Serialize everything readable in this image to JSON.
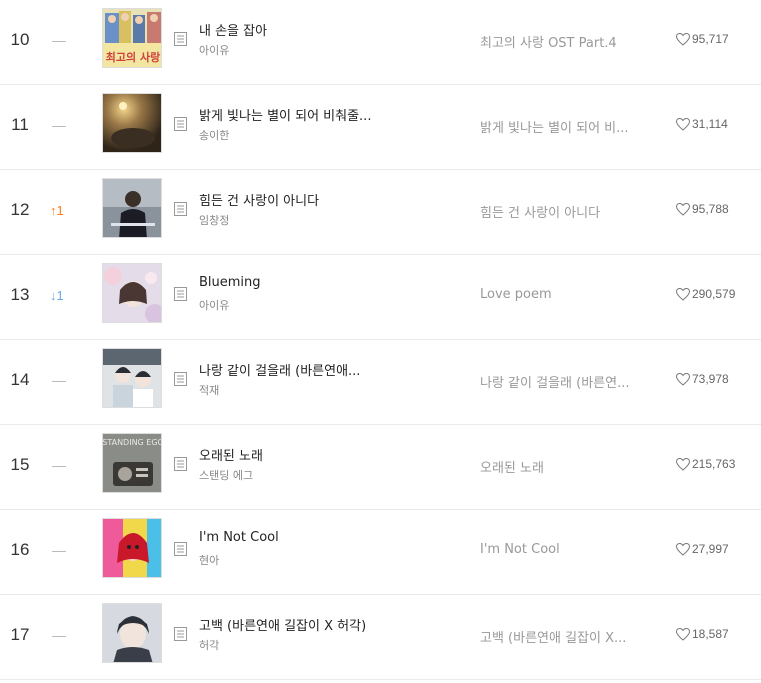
{
  "rows": [
    {
      "rank": "10",
      "change": "—",
      "change_dir": "none",
      "title": "내 손을 잡아",
      "artist": "아이유",
      "album": "최고의 사랑 OST Part.4",
      "likes": "95,717"
    },
    {
      "rank": "11",
      "change": "—",
      "change_dir": "none",
      "title": "밝게 빛나는 별이 되어 비춰줄...",
      "artist": "송이한",
      "album": "밝게 빛나는 별이 되어 비...",
      "likes": "31,114"
    },
    {
      "rank": "12",
      "change": "↑1",
      "change_dir": "up",
      "title": "힘든 건 사랑이 아니다",
      "artist": "임창정",
      "album": "힘든 건 사랑이 아니다",
      "likes": "95,788"
    },
    {
      "rank": "13",
      "change": "↓1",
      "change_dir": "down",
      "title": "Blueming",
      "artist": "아이유",
      "album": "Love poem",
      "likes": "290,579"
    },
    {
      "rank": "14",
      "change": "—",
      "change_dir": "none",
      "title": "나랑 같이 걸을래 (바른연애...",
      "artist": "적재",
      "album": "나랑 같이 걸을래 (바른연...",
      "likes": "73,978"
    },
    {
      "rank": "15",
      "change": "—",
      "change_dir": "none",
      "title": "오래된 노래",
      "artist": "스탠딩 에그",
      "album": "오래된 노래",
      "likes": "215,763"
    },
    {
      "rank": "16",
      "change": "—",
      "change_dir": "none",
      "title": "I'm Not Cool",
      "artist": "현아",
      "album": "I'm Not Cool",
      "likes": "27,997"
    },
    {
      "rank": "17",
      "change": "—",
      "change_dir": "none",
      "title": "고백 (바른연애 길잡이 X 허각)",
      "artist": "허각",
      "album": "고백 (바른연애 길잡이 X...",
      "likes": "18,587"
    }
  ],
  "art_logos": {
    "best_love": "최고의 사랑",
    "standing_egg": "STANDING EGG"
  },
  "colors": {
    "up": "#ff7a1a",
    "down": "#6aa7e6",
    "dash": "#bbbbbb"
  },
  "icons": {
    "lyrics": "lyrics-icon",
    "like": "heart-icon"
  }
}
